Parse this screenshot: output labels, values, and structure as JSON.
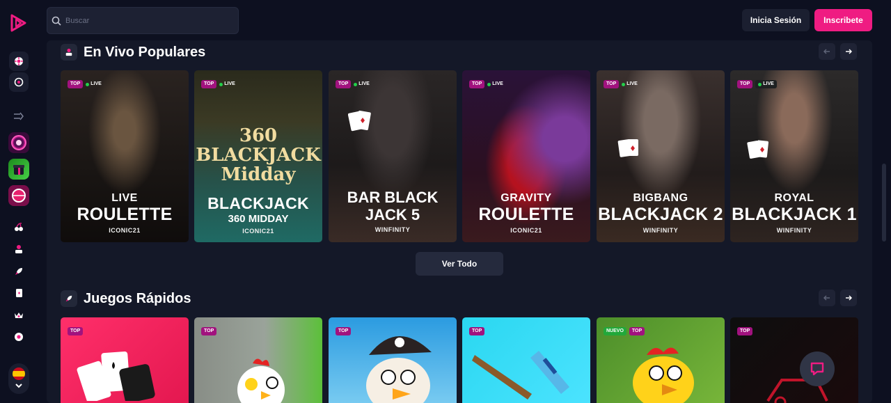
{
  "header": {
    "search_placeholder": "Buscar",
    "login_label": "Inicia Sesión",
    "register_label": "Inscribete"
  },
  "colors": {
    "accent": "#ef1c82",
    "background": "#0d1020",
    "panel": "#141828",
    "live": "#23d04a"
  },
  "sidebar": {
    "icons": [
      "casino-chip-icon",
      "live-wheel-icon",
      "collapse-icon",
      "cherries-icon",
      "dealer-icon",
      "rocket-icon",
      "cards-icon",
      "crown-icon",
      "roulette-icon"
    ],
    "game_thumbs": [
      "roulette-thumb",
      "gift-thumb",
      "wheel-thumb"
    ],
    "language_flag": "spain-flag"
  },
  "sections": [
    {
      "title": "En Vivo Populares",
      "icon": "dealer-icon",
      "view_all_label": "Ver Todo",
      "cards": [
        {
          "tags": [
            "TOP",
            "LIVE"
          ],
          "line1": "LIVE",
          "line2": "ROULETTE",
          "provider": "ICONIC21"
        },
        {
          "tags": [
            "TOP",
            "LIVE"
          ],
          "logo": "360 BLACKJACK Midday",
          "line1": "BLACKJACK",
          "line2": "360 MIDDAY",
          "provider": "ICONIC21"
        },
        {
          "tags": [
            "TOP",
            "LIVE"
          ],
          "line1": "BAR BLACK",
          "line2": "JACK 5",
          "provider": "WINFINITY"
        },
        {
          "tags": [
            "TOP",
            "LIVE"
          ],
          "line1": "GRAVITY",
          "line2": "ROULETTE",
          "provider": "ICONIC21"
        },
        {
          "tags": [
            "TOP",
            "LIVE"
          ],
          "line1": "BIGBANG",
          "line2": "BLACKJACK 2",
          "provider": "WINFINITY"
        },
        {
          "tags": [
            "TOP",
            "LIVE"
          ],
          "line1": "ROYAL",
          "line2": "BLACKJACK 1",
          "provider": "WINFINITY"
        }
      ]
    },
    {
      "title": "Juegos Rápidos",
      "icon": "rocket-icon",
      "cards": [
        {
          "tags": [
            "TOP"
          ]
        },
        {
          "tags": [
            "TOP"
          ]
        },
        {
          "tags": [
            "TOP"
          ]
        },
        {
          "tags": [
            "TOP"
          ]
        },
        {
          "tags": [
            "NUEVO",
            "TOP"
          ]
        },
        {
          "tags": [
            "TOP"
          ]
        }
      ]
    }
  ],
  "tag_labels": {
    "top": "TOP",
    "live": "LIVE",
    "new": "NUEVO"
  }
}
